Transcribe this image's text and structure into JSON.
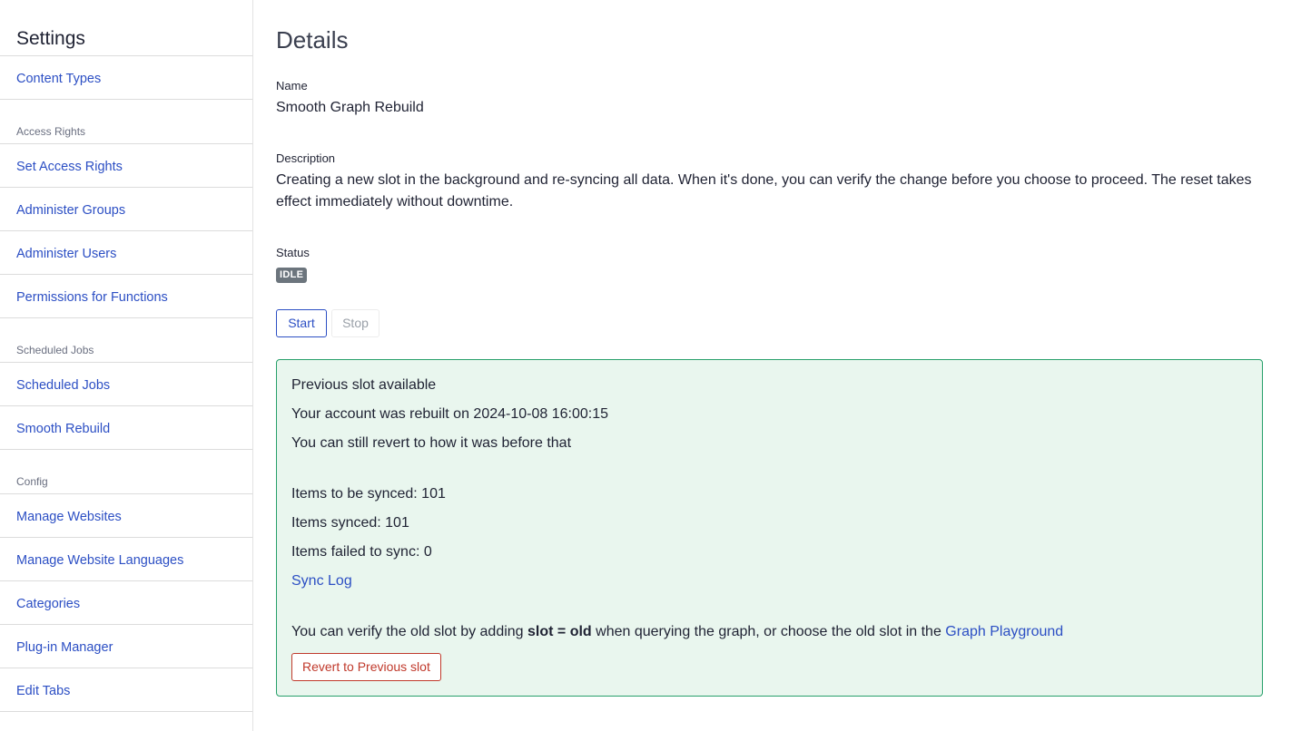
{
  "sidebar": {
    "title": "Settings",
    "content_types": "Content Types",
    "access_rights": {
      "heading": "Access Rights",
      "items": [
        "Set Access Rights",
        "Administer Groups",
        "Administer Users",
        "Permissions for Functions"
      ]
    },
    "scheduled_jobs": {
      "heading": "Scheduled Jobs",
      "items": [
        "Scheduled Jobs",
        "Smooth Rebuild"
      ]
    },
    "config": {
      "heading": "Config",
      "items": [
        "Manage Websites",
        "Manage Website Languages",
        "Categories",
        "Plug-in Manager",
        "Edit Tabs"
      ]
    }
  },
  "details": {
    "title": "Details",
    "name_label": "Name",
    "name_value": "Smooth Graph Rebuild",
    "description_label": "Description",
    "description_value": "Creating a new slot in the background and re-syncing all data. When it's done, you can verify the change before you choose to proceed. The reset takes effect immediately without downtime.",
    "status_label": "Status",
    "status_value": "IDLE",
    "start_label": "Start",
    "stop_label": "Stop"
  },
  "panel": {
    "title": "Previous slot available",
    "rebuilt_line": "Your account was rebuilt on 2024-10-08 16:00:15",
    "revert_hint": "You can still revert to how it was before that",
    "items_to_sync": "Items to be synced: 101",
    "items_synced": "Items synced: 101",
    "items_failed": "Items failed to sync: 0",
    "sync_log": "Sync Log",
    "verify_prefix": "You can verify the old slot by adding ",
    "verify_code": "slot = old",
    "verify_middle": " when querying the graph, or choose the old slot in the ",
    "graph_playground": "Graph Playground",
    "revert_button": "Revert to Previous slot"
  },
  "colors": {
    "link": "#2c4fc4",
    "panel_bg": "#e9f6ee",
    "panel_border": "#27a06a",
    "badge_bg": "#6c757d",
    "danger": "#c0392b"
  }
}
